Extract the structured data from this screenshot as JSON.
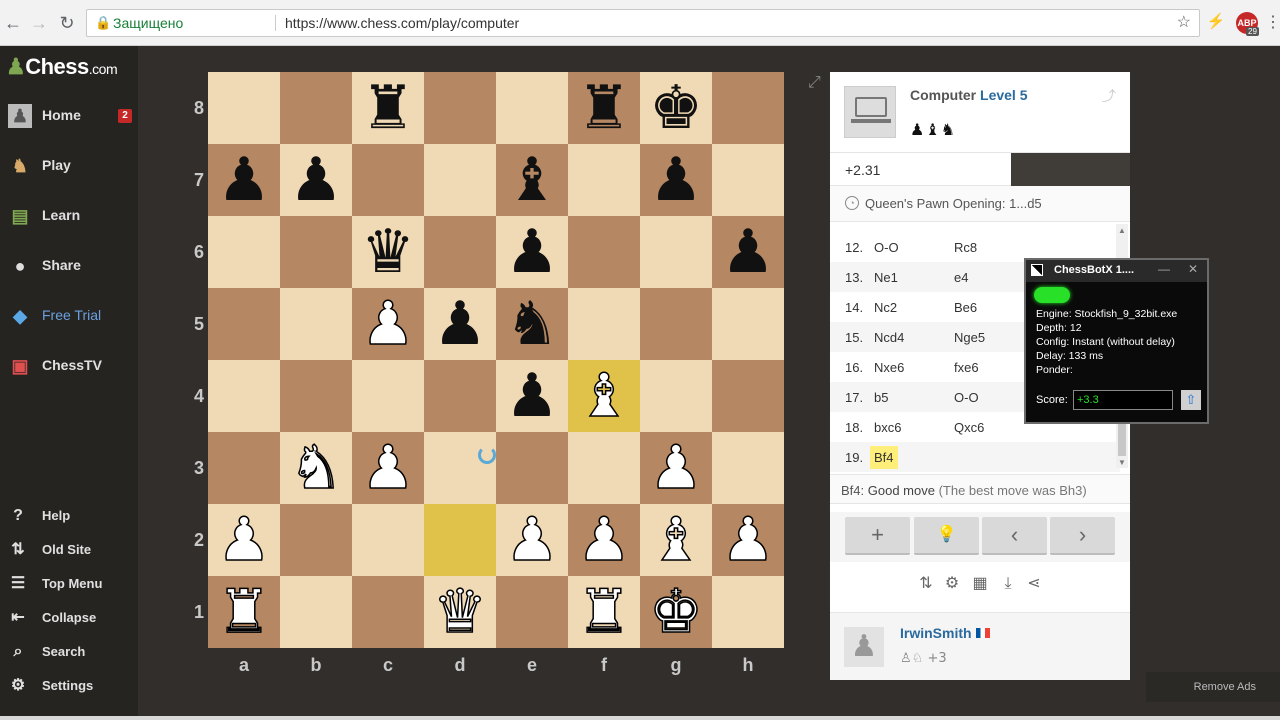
{
  "browser": {
    "secure_label": "Защищено",
    "url_host": "https://www.chess.com",
    "url_path": "/play/computer",
    "ext_badge_label": "ABP",
    "ext_badge_count": "29"
  },
  "sidebar": {
    "logo_text": "Chess",
    "logo_suffix": ".com",
    "items": [
      {
        "label": "Home",
        "icon": "pawn-icon",
        "badge": "2"
      },
      {
        "label": "Play",
        "icon": "play-icon"
      },
      {
        "label": "Learn",
        "icon": "learn-icon"
      },
      {
        "label": "Share",
        "icon": "share-icon"
      },
      {
        "label": "Free Trial",
        "icon": "diamond-icon"
      },
      {
        "label": "ChessTV",
        "icon": "tv-icon"
      }
    ],
    "bottom_items": [
      {
        "label": "Help",
        "icon": "help-icon"
      },
      {
        "label": "Old Site",
        "icon": "old-site-icon"
      },
      {
        "label": "Top Menu",
        "icon": "menu-icon"
      },
      {
        "label": "Collapse",
        "icon": "collapse-icon"
      },
      {
        "label": "Search",
        "icon": "search-icon"
      },
      {
        "label": "Settings",
        "icon": "gear-icon"
      }
    ]
  },
  "board": {
    "ranks": [
      "8",
      "7",
      "6",
      "5",
      "4",
      "3",
      "2",
      "1"
    ],
    "files": [
      "a",
      "b",
      "c",
      "d",
      "e",
      "f",
      "g",
      "h"
    ],
    "position": {
      "c8": "bR",
      "f8": "bR",
      "g8": "bK",
      "a7": "bP",
      "b7": "bP",
      "e7": "bB",
      "g7": "bP",
      "c6": "bQ",
      "e6": "bP",
      "h6": "bP",
      "c5": "wP",
      "d5": "bP",
      "e5": "bN",
      "e4": "bP",
      "f4": "wB",
      "b3": "wN",
      "c3": "wP",
      "g3": "wP",
      "a2": "wP",
      "e2": "wP",
      "f2": "wP",
      "g2": "wB",
      "h2": "wP",
      "a1": "wR",
      "d1": "wQ",
      "f1": "wR",
      "g1": "wK"
    },
    "highlighted": [
      "f4",
      "d2"
    ]
  },
  "opponent": {
    "name": "Computer",
    "level": "Level 5",
    "captured": "♟♝♞"
  },
  "evaluation": "+2.31",
  "opening": "Queen's Pawn Opening: 1...d5",
  "moves": [
    {
      "n": "12.",
      "w": "O-O",
      "b": "Rc8"
    },
    {
      "n": "13.",
      "w": "Ne1",
      "b": "e4"
    },
    {
      "n": "14.",
      "w": "Nc2",
      "b": "Be6"
    },
    {
      "n": "15.",
      "w": "Ncd4",
      "b": "Nge5"
    },
    {
      "n": "16.",
      "w": "Nxe6",
      "b": "fxe6"
    },
    {
      "n": "17.",
      "w": "b5",
      "b": "O-O"
    },
    {
      "n": "18.",
      "w": "bxc6",
      "b": "Qxc6"
    },
    {
      "n": "19.",
      "w": "Bf4",
      "b": ""
    }
  ],
  "feedback": {
    "move": "Bf4:",
    "verdict": "Good move",
    "note": "(The best move was Bh3)"
  },
  "controls": {
    "new_game": "+",
    "hint": "💡",
    "back": "‹",
    "forward": "›"
  },
  "player": {
    "name": "IrwinSmith",
    "captured_count": "+3"
  },
  "chessbotx": {
    "title": "ChessBotX 1....",
    "engine": "Engine: Stockfish_9_32bit.exe",
    "depth": "Depth: 12",
    "config": "Config: Instant (without delay)",
    "delay": "Delay: 133 ms",
    "ponder": "Ponder:",
    "score_label": "Score:",
    "score_value": "+3.3"
  },
  "remove_ads": "Remove Ads"
}
